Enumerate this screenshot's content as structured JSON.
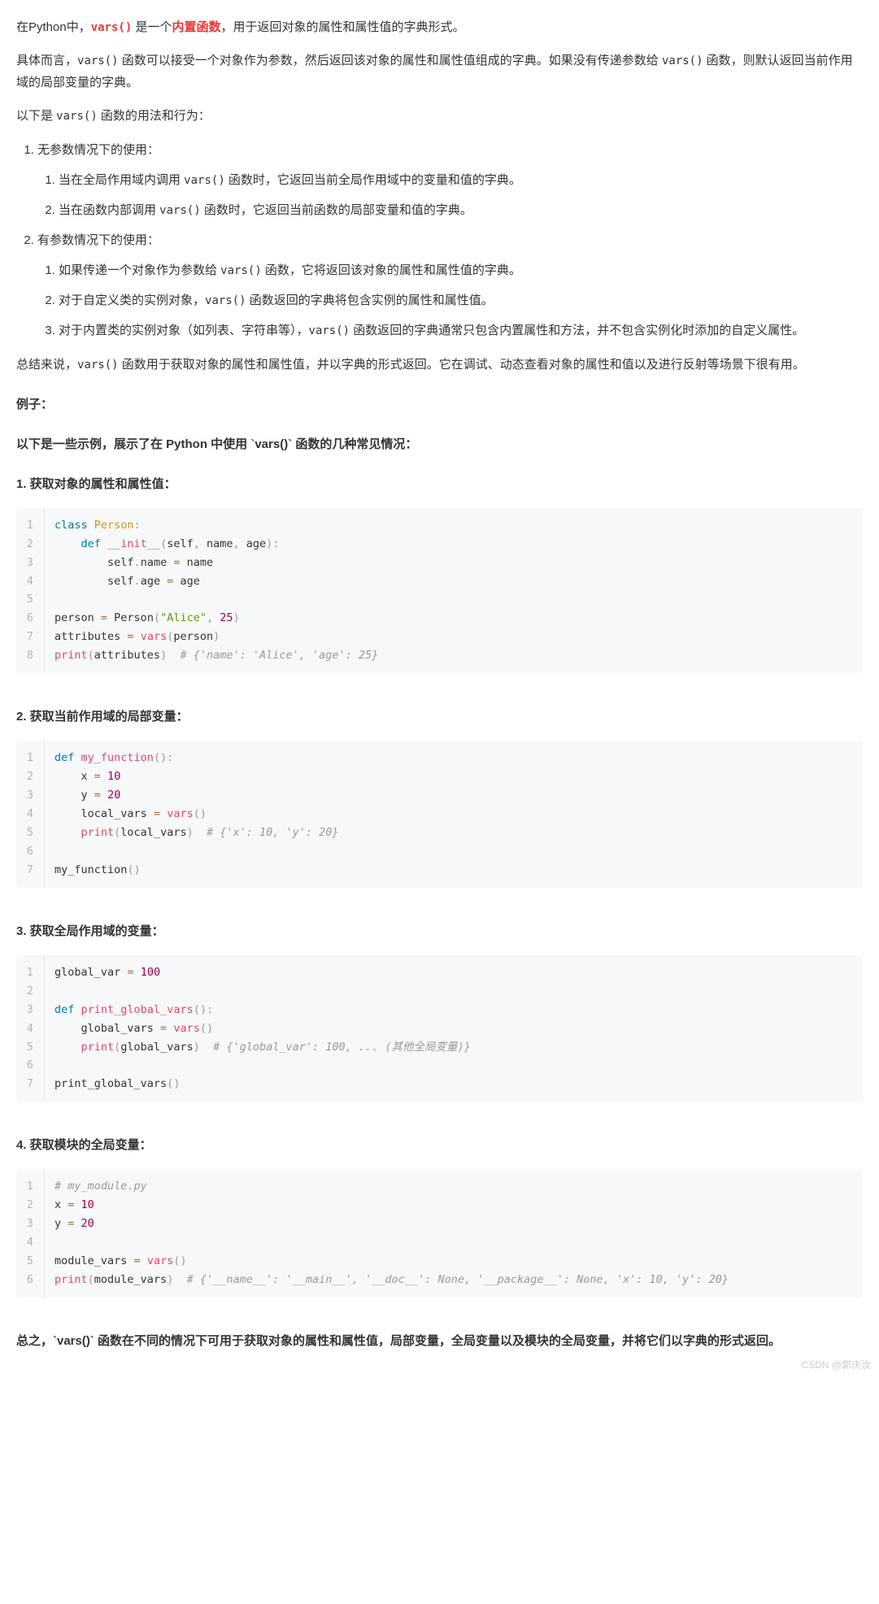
{
  "intro": {
    "p1_pre": "在Python中，",
    "p1_code": "vars()",
    "p1_mid": " 是一个",
    "p1_hilite": "内置函数",
    "p1_post": "，用于返回对象的属性和属性值的字典形式。",
    "p2_pre": "具体而言，",
    "p2_c1": "vars()",
    "p2_mid1": " 函数可以接受一个对象作为参数，然后返回该对象的属性和属性值组成的字典。如果没有传递参数给 ",
    "p2_c2": "vars()",
    "p2_mid2": " 函数，则默认返回当前作用域的局部变量的字典。",
    "p3_pre": "以下是 ",
    "p3_code": "vars()",
    "p3_post": " 函数的用法和行为："
  },
  "list1": {
    "i1": "无参数情况下的使用：",
    "i1_1_pre": "当在全局作用域内调用 ",
    "i1_1_code": "vars()",
    "i1_1_post": " 函数时，它返回当前全局作用域中的变量和值的字典。",
    "i1_2_pre": "当在函数内部调用 ",
    "i1_2_code": "vars()",
    "i1_2_post": " 函数时，它返回当前函数的局部变量和值的字典。",
    "i2": "有参数情况下的使用：",
    "i2_1_pre": "如果传递一个对象作为参数给 ",
    "i2_1_code": "vars()",
    "i2_1_post": " 函数，它将返回该对象的属性和属性值的字典。",
    "i2_2_pre": "对于自定义类的实例对象，",
    "i2_2_code": "vars()",
    "i2_2_post": " 函数返回的字典将包含实例的属性和属性值。",
    "i2_3_pre": "对于内置类的实例对象（如列表、字符串等），",
    "i2_3_code": "vars()",
    "i2_3_post": " 函数返回的字典通常只包含内置属性和方法，并不包含实例化时添加的自定义属性。"
  },
  "summary1_pre": "总结来说，",
  "summary1_code": "vars()",
  "summary1_post": " 函数用于获取对象的属性和属性值，并以字典的形式返回。它在调试、动态查看对象的属性和值以及进行反射等场景下很有用。",
  "examples_head": "例子：",
  "examples_intro": "以下是一些示例，展示了在 Python 中使用 `vars()` 函数的几种常见情况：",
  "ex1": {
    "title": "1. 获取对象的属性和属性值："
  },
  "ex2": {
    "title": "2. 获取当前作用域的局部变量："
  },
  "ex3": {
    "title": "3. 获取全局作用域的变量："
  },
  "ex4": {
    "title": "4. 获取模块的全局变量："
  },
  "code1": {
    "lines": 8,
    "text": "class Person:\n    def __init__(self, name, age):\n        self.name = name\n        self.age = age\n\nperson = Person(\"Alice\", 25)\nattributes = vars(person)\nprint(attributes)  # {'name': 'Alice', 'age': 25}"
  },
  "code2": {
    "lines": 7,
    "text": "def my_function():\n    x = 10\n    y = 20\n    local_vars = vars()\n    print(local_vars)  # {'x': 10, 'y': 20}\n\nmy_function()"
  },
  "code3": {
    "lines": 7,
    "text": "global_var = 100\n\ndef print_global_vars():\n    global_vars = vars()\n    print(global_vars)  # {'global_var': 100, ... (其他全局变量)}\n\nprint_global_vars()"
  },
  "code4": {
    "lines": 6,
    "text": "# my_module.py\nx = 10\ny = 20\n\nmodule_vars = vars()\nprint(module_vars)  # {'__name__': '__main__', '__doc__': None, '__package__': None, 'x': 10, 'y': 20}"
  },
  "conclusion": "总之，`vars()` 函数在不同的情况下可用于获取对象的属性和属性值，局部变量，全局变量以及模块的全局变量，并将它们以字典的形式返回。",
  "watermark": "CSDN @郭庆汝"
}
